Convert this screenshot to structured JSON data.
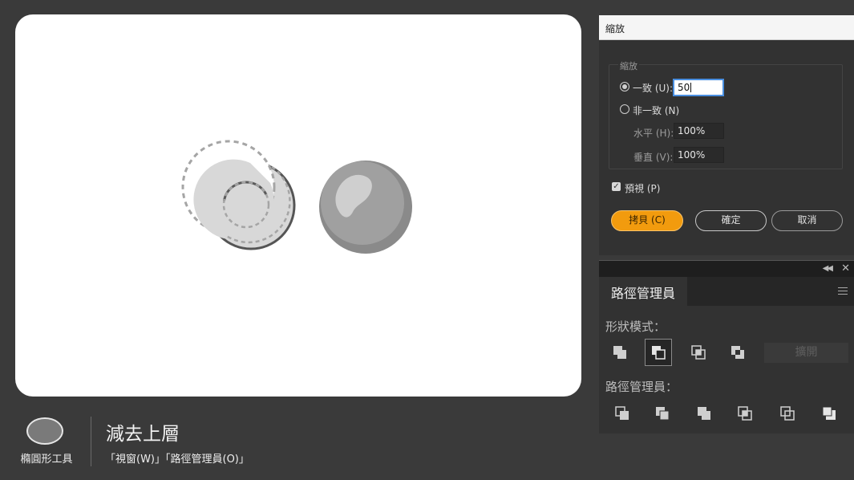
{
  "caption": {
    "tool_label": "橢圓形工具",
    "title": "減去上層",
    "menu_path": "「視窗(W)」「路徑管理員(O)」"
  },
  "scale_dialog": {
    "title": "縮放",
    "group_label": "縮放",
    "uniform_label": "一致 (U):",
    "uniform_value": "50",
    "uniform_selected": true,
    "non_uniform_label": "非一致 (N)",
    "horizontal_label": "水平 (H):",
    "horizontal_value": "100%",
    "vertical_label": "垂直 (V):",
    "vertical_value": "100%",
    "preview_label": "預視 (P)",
    "preview_checked": true,
    "copy_label": "拷貝 (C)",
    "ok_label": "確定",
    "cancel_label": "取消"
  },
  "pathfinder": {
    "tab_label": "路徑管理員",
    "shape_modes_label": "形狀模式：",
    "expand_label": "擴開",
    "pathfinders_label": "路徑管理員：",
    "shape_mode_icons": [
      "unite-icon",
      "minus-front-icon",
      "intersect-icon",
      "exclude-icon"
    ],
    "pathfinder_icons": [
      "divide-icon",
      "trim-icon",
      "merge-icon",
      "crop-icon",
      "outline-icon",
      "minus-back-icon"
    ]
  },
  "colors": {
    "accent": "#f29b0e",
    "canvas": "#ffffff",
    "background": "#3a3a3a"
  }
}
